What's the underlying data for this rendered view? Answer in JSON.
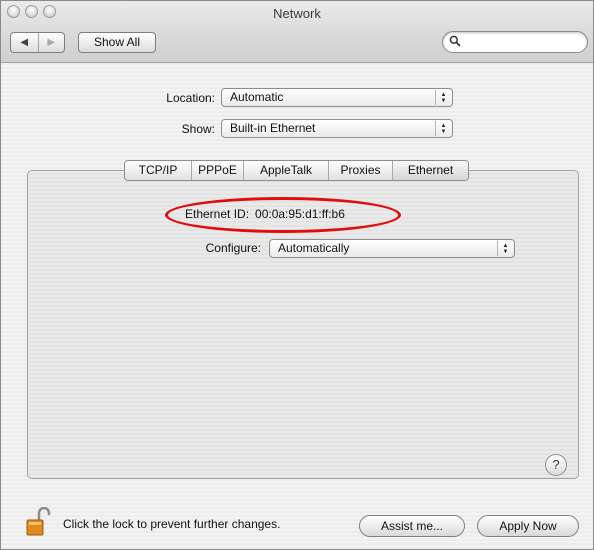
{
  "window": {
    "title": "Network"
  },
  "toolbar": {
    "back_glyph": "◀",
    "forward_glyph": "▶",
    "show_all_label": "Show All",
    "search": {
      "value": "",
      "icon": "magnifier-icon"
    }
  },
  "location": {
    "label": "Location:",
    "value": "Automatic"
  },
  "show": {
    "label": "Show:",
    "value": "Built-in Ethernet"
  },
  "tabs": [
    {
      "label": "TCP/IP"
    },
    {
      "label": "PPPoE"
    },
    {
      "label": "AppleTalk"
    },
    {
      "label": "Proxies"
    },
    {
      "label": "Ethernet"
    }
  ],
  "active_tab": "Ethernet",
  "ethernet": {
    "id_label": "Ethernet ID:",
    "id_value": "00:0a:95:d1:ff:b6",
    "configure_label": "Configure:",
    "configure_value": "Automatically"
  },
  "help_glyph": "?",
  "footer": {
    "lock_text": "Click the lock to prevent further changes.",
    "assist_label": "Assist me...",
    "apply_label": "Apply Now"
  },
  "colors": {
    "highlight_oval": "#e10c0c",
    "lock_body": "#e08a1e"
  }
}
